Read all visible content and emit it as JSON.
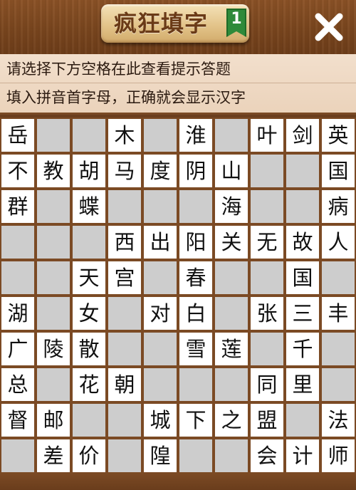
{
  "header": {
    "title": "疯狂填字",
    "level": "1"
  },
  "hints": {
    "line1": "请选择下方空格在此查看提示答题",
    "line2": "填入拼音首字母，正确就会显示汉字"
  },
  "grid": [
    [
      "岳",
      "#",
      "#",
      "木",
      "#",
      "淮",
      "#",
      "叶",
      "剑",
      "英"
    ],
    [
      "不",
      "教",
      "胡",
      "马",
      "度",
      "阴",
      "山",
      "#",
      "#",
      "国"
    ],
    [
      "群",
      "#",
      "蝶",
      "#",
      "#",
      "#",
      "海",
      "#",
      "#",
      "病"
    ],
    [
      "#",
      "#",
      "#",
      "西",
      "出",
      "阳",
      "关",
      "无",
      "故",
      "人"
    ],
    [
      "#",
      "#",
      "天",
      "宫",
      "#",
      "春",
      "#",
      "#",
      "国",
      "#"
    ],
    [
      "湖",
      "#",
      "女",
      "#",
      "对",
      "白",
      "#",
      "张",
      "三",
      "丰"
    ],
    [
      "广",
      "陵",
      "散",
      "#",
      "#",
      "雪",
      "莲",
      "#",
      "千",
      "#"
    ],
    [
      "总",
      "#",
      "花",
      "朝",
      "#",
      "#",
      "#",
      "同",
      "里",
      "#"
    ],
    [
      "督",
      "邮",
      "#",
      "#",
      "城",
      "下",
      "之",
      "盟",
      "#",
      "法"
    ],
    [
      "#",
      "差",
      "价",
      "#",
      "隍",
      "#",
      "#",
      "会",
      "计",
      "师"
    ]
  ],
  "colors": {
    "wood": "#7b4a24",
    "cell_white": "#ffffff",
    "cell_gray": "#cdcdcd",
    "ribbon": "#2f8a3a"
  }
}
